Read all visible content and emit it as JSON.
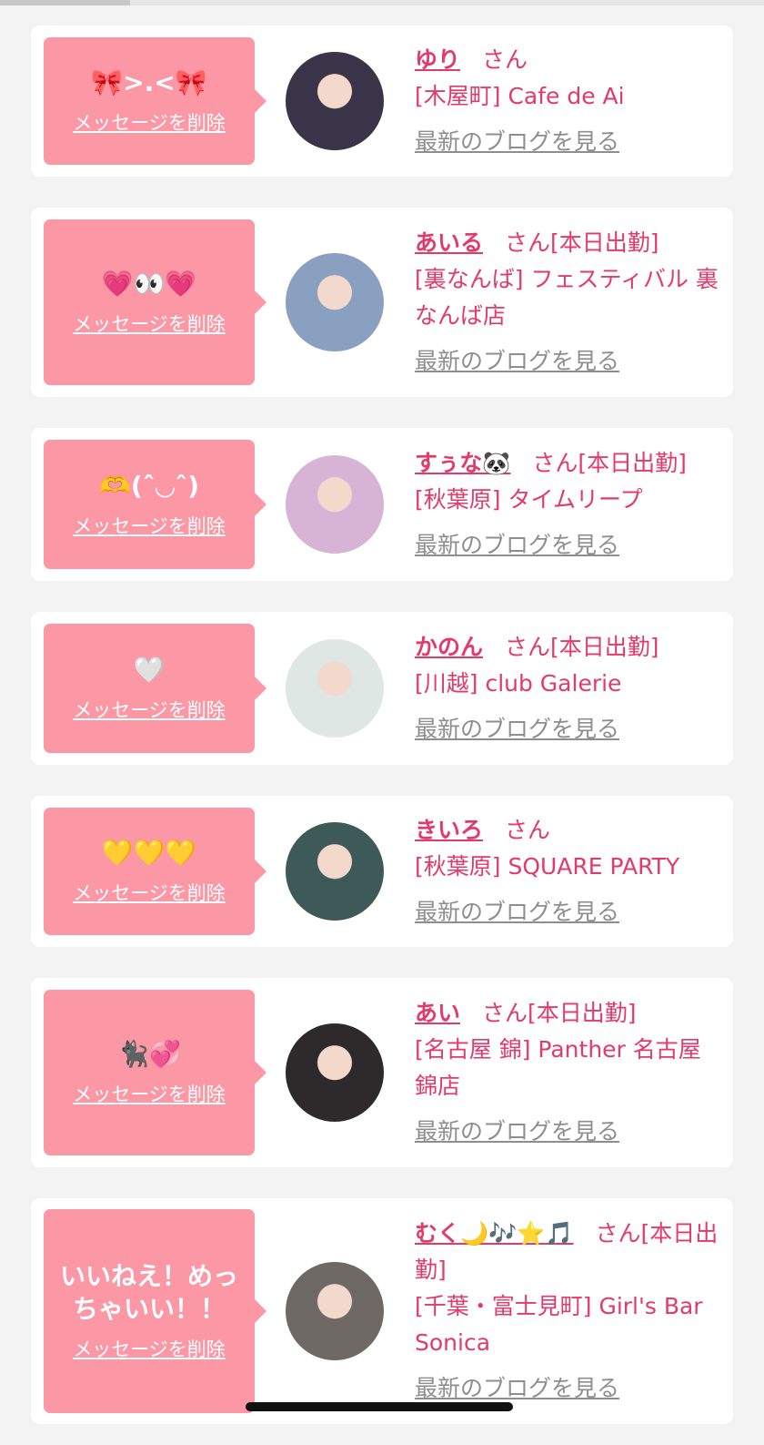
{
  "load_progress": 0.17,
  "colors": {
    "accent": "#e33a6a",
    "bubble": "#fc97a6",
    "muted": "#8e8e8e",
    "background": "#f3f3f3"
  },
  "cards": [
    {
      "message": "🎀>.<🎀",
      "delete_label": "メッセージを削除",
      "name": "ゆり",
      "suffix": "さん",
      "shop": "[木屋町] Cafe de Ai",
      "blog_label": "最新のブログを見る",
      "avatar_color": "#3a3448"
    },
    {
      "message": "💗👀💗",
      "delete_label": "メッセージを削除",
      "name": "あいる",
      "suffix": "さん[本日出勤]",
      "shop": "[裏なんば] フェスティバル 裏なんば店",
      "blog_label": "最新のブログを見る",
      "avatar_color": "#8aa0c0"
    },
    {
      "message": "🫶(ˆ◡ˆ)",
      "delete_label": "メッセージを削除",
      "name": "すぅな🐼",
      "suffix": "さん[本日出勤]",
      "shop": "[秋葉原] タイムリープ",
      "blog_label": "最新のブログを見る",
      "avatar_color": "#d7b3d6"
    },
    {
      "message": "🤍",
      "delete_label": "メッセージを削除",
      "name": "かのん",
      "suffix": "さん[本日出勤]",
      "shop": "[川越] club Galerie",
      "blog_label": "最新のブログを見る",
      "avatar_color": "#dfe7e4"
    },
    {
      "message": "💛💛💛",
      "delete_label": "メッセージを削除",
      "name": "きいろ",
      "suffix": "さん",
      "shop": "[秋葉原] SQUARE PARTY",
      "blog_label": "最新のブログを見る",
      "avatar_color": "#3e5a58"
    },
    {
      "message": "🐈‍⬛💞",
      "delete_label": "メッセージを削除",
      "name": "あい",
      "suffix": "さん[本日出勤]",
      "shop": "[名古屋 錦] Panther 名古屋錦店",
      "blog_label": "最新のブログを見る",
      "avatar_color": "#2e2a2c"
    },
    {
      "message": "いいねえ！めっちゃいい！！",
      "delete_label": "メッセージを削除",
      "name": "むく🌙🎶⭐️🎵",
      "suffix": "さん[本日出勤]",
      "shop": "[千葉・富士見町] Girl's Bar Sonica",
      "blog_label": "最新のブログを見る",
      "avatar_color": "#6f6965"
    }
  ]
}
